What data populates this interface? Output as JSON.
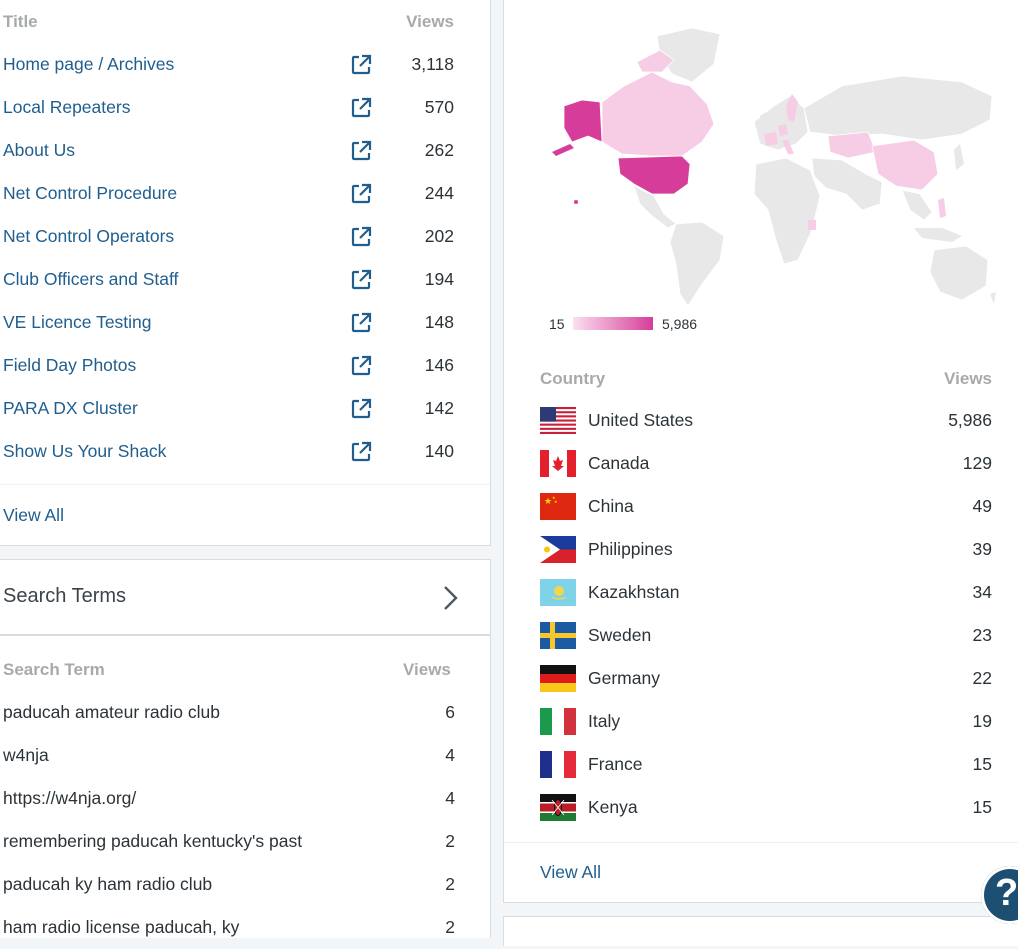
{
  "posts": {
    "col_title": "Title",
    "col_views": "Views",
    "rows": [
      {
        "title": "Home page / Archives",
        "views": "3,118"
      },
      {
        "title": "Local Repeaters",
        "views": "570"
      },
      {
        "title": "About Us",
        "views": "262"
      },
      {
        "title": "Net Control Procedure",
        "views": "244"
      },
      {
        "title": "Net Control Operators",
        "views": "202"
      },
      {
        "title": "Club Officers and Staff",
        "views": "194"
      },
      {
        "title": "VE Licence Testing",
        "views": "148"
      },
      {
        "title": "Field Day Photos",
        "views": "146"
      },
      {
        "title": "PARA DX Cluster",
        "views": "142"
      },
      {
        "title": "Show Us Your Shack",
        "views": "140"
      }
    ],
    "view_all": "View All",
    "external_icon": "external-link-icon"
  },
  "search": {
    "title": "Search Terms",
    "chevron_icon": "chevron-right-icon",
    "col_term": "Search Term",
    "col_views": "Views",
    "rows": [
      {
        "term": "paducah amateur radio club",
        "views": "6"
      },
      {
        "term": "w4nja",
        "views": "4"
      },
      {
        "term": "https://w4nja.org/",
        "views": "4"
      },
      {
        "term": "remembering paducah kentucky's past",
        "views": "2"
      },
      {
        "term": "paducah ky ham radio club",
        "views": "2"
      },
      {
        "term": "ham radio license paducah, ky",
        "views": "2"
      }
    ]
  },
  "countries": {
    "legend_min": "15",
    "legend_max": "5,986",
    "colors": {
      "low": "#fbe0f0",
      "high": "#d63d9a",
      "none": "#e8e8e8"
    },
    "col_country": "Country",
    "col_views": "Views",
    "rows": [
      {
        "name": "United States",
        "views": "5,986",
        "flag": "us-flag-icon"
      },
      {
        "name": "Canada",
        "views": "129",
        "flag": "canada-flag-icon"
      },
      {
        "name": "China",
        "views": "49",
        "flag": "china-flag-icon"
      },
      {
        "name": "Philippines",
        "views": "39",
        "flag": "philippines-flag-icon"
      },
      {
        "name": "Kazakhstan",
        "views": "34",
        "flag": "kazakhstan-flag-icon"
      },
      {
        "name": "Sweden",
        "views": "23",
        "flag": "sweden-flag-icon"
      },
      {
        "name": "Germany",
        "views": "22",
        "flag": "germany-flag-icon"
      },
      {
        "name": "Italy",
        "views": "19",
        "flag": "italy-flag-icon"
      },
      {
        "name": "France",
        "views": "15",
        "flag": "france-flag-icon"
      },
      {
        "name": "Kenya",
        "views": "15",
        "flag": "kenya-flag-icon"
      }
    ],
    "view_all": "View All"
  },
  "help": {
    "label": "?",
    "icon": "help-icon"
  }
}
